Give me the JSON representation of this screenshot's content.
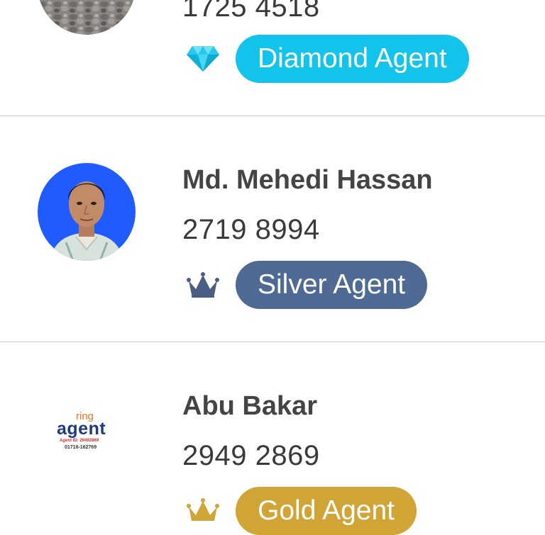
{
  "rows": [
    {
      "agent_id": "1725 4518",
      "tier_label": "Diamond Agent",
      "tier_icon": "diamond-icon",
      "badge_color": "#12c3ec"
    },
    {
      "name": "Md. Mehedi Hassan",
      "agent_id": "2719 8994",
      "tier_label": "Silver Agent",
      "tier_icon": "crown-icon",
      "badge_color": "#4f6a93"
    },
    {
      "name": "Abu Bakar",
      "agent_id": "2949 2869",
      "tier_label": "Gold Agent",
      "tier_icon": "gold-crown-icon",
      "badge_color": "#d0a535",
      "logo": {
        "line1": "ring",
        "line2": "agent",
        "line3": "Agent ID: 29492869",
        "line4": "01716-162769"
      }
    }
  ]
}
